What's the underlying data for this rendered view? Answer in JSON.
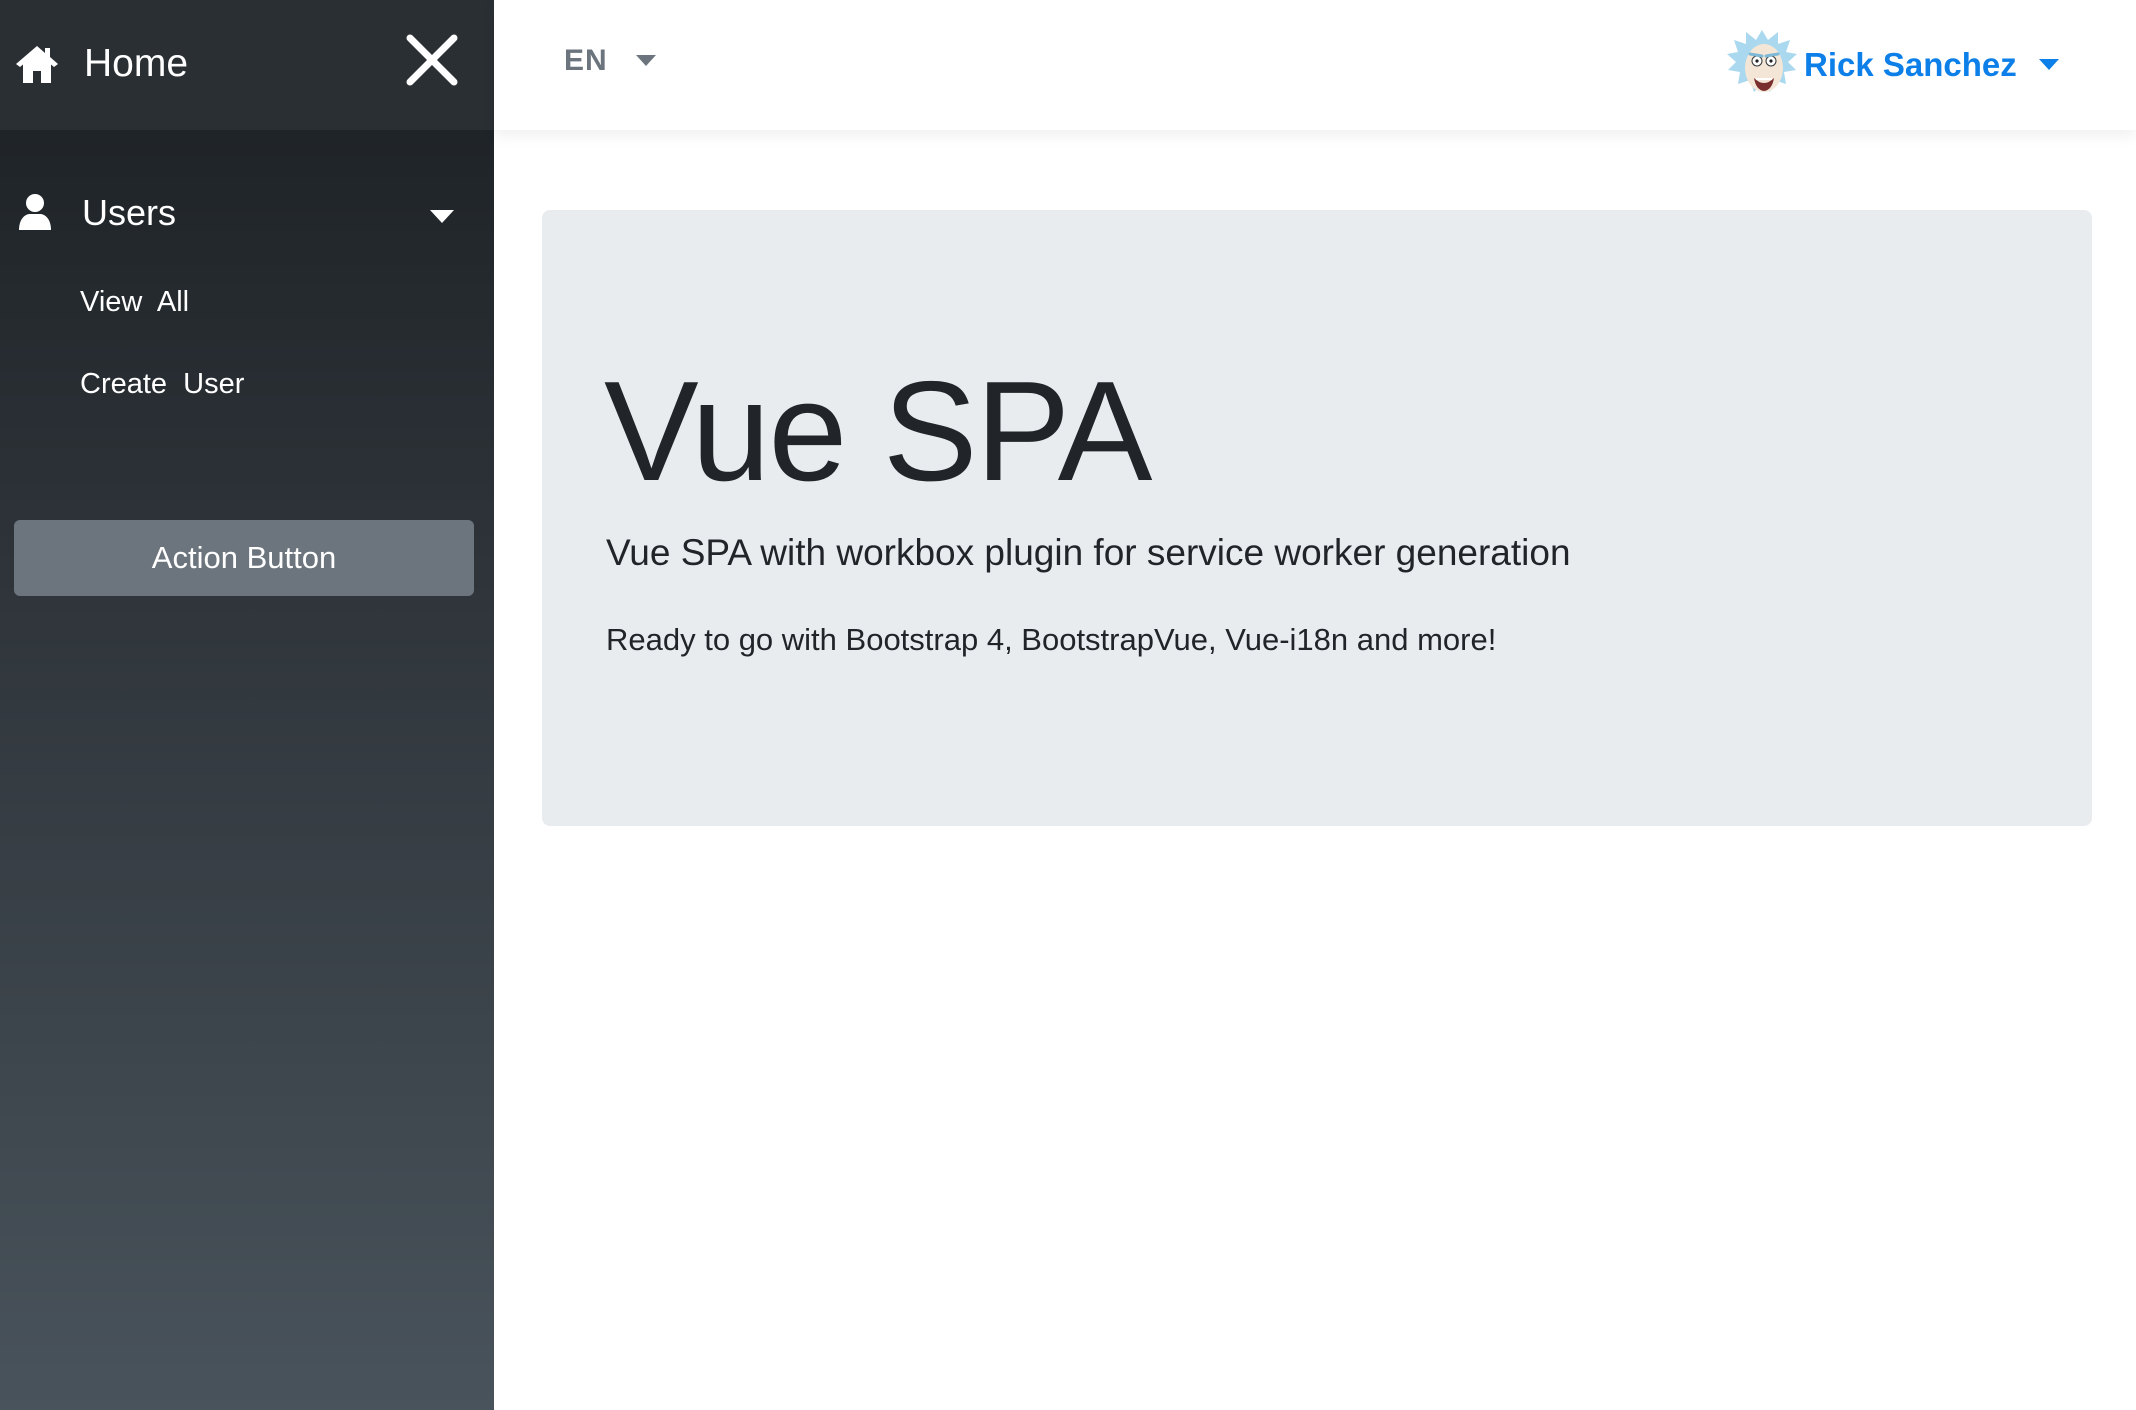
{
  "sidebar": {
    "home_label": "Home",
    "users_label": "Users",
    "items": [
      {
        "label": "View  All"
      },
      {
        "label": "Create  User"
      }
    ],
    "action_button_label": "Action Button"
  },
  "topbar": {
    "language": "EN",
    "user_name": "Rick Sanchez"
  },
  "main": {
    "title": "Vue SPA",
    "lead": "Vue SPA with workbox plugin for service worker generation",
    "text": "Ready to go with Bootstrap 4, BootstrapVue, Vue-i18n and more!"
  },
  "colors": {
    "sidebar_dark": "#1e2226",
    "action_button": "#6c757d",
    "jumbotron_bg": "#e9ecef",
    "user_link": "#0d7fe8"
  },
  "icons": [
    "home-icon",
    "close-icon",
    "user-icon",
    "caret-down-icon",
    "avatar"
  ]
}
